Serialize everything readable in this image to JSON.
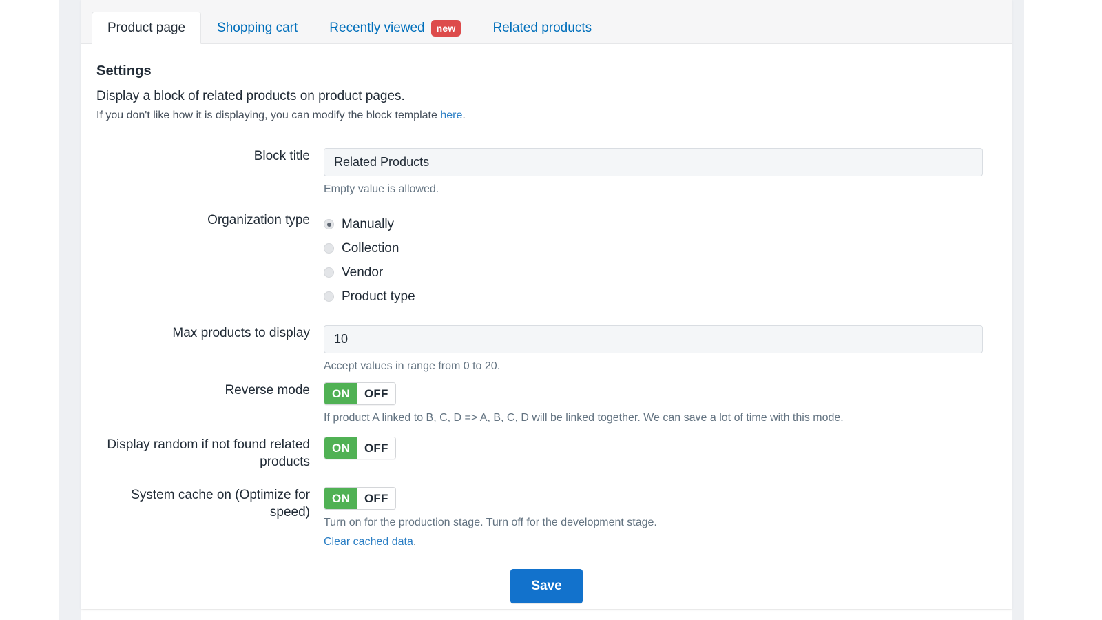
{
  "tabs": [
    {
      "label": "Product page",
      "active": true,
      "badge": null
    },
    {
      "label": "Shopping cart",
      "active": false,
      "badge": null
    },
    {
      "label": "Recently viewed",
      "active": false,
      "badge": "new"
    },
    {
      "label": "Related products",
      "active": false,
      "badge": null
    }
  ],
  "settings": {
    "title": "Settings",
    "description": "Display a block of related products on product pages.",
    "sub_prefix": "If you don't like how it is displaying, you can modify the block template ",
    "sub_link": "here",
    "sub_suffix": "."
  },
  "fields": {
    "block_title": {
      "label": "Block title",
      "value": "Related Products",
      "placeholder": "",
      "help": "Empty value is allowed."
    },
    "organization_type": {
      "label": "Organization type",
      "options": [
        {
          "label": "Manually",
          "checked": true
        },
        {
          "label": "Collection",
          "checked": false
        },
        {
          "label": "Vendor",
          "checked": false
        },
        {
          "label": "Product type",
          "checked": false
        }
      ]
    },
    "max_products": {
      "label": "Max products to display",
      "value": "10",
      "placeholder": "",
      "help": "Accept values in range from 0 to 20."
    },
    "reverse_mode": {
      "label": "Reverse mode",
      "on_label": "ON",
      "off_label": "OFF",
      "state": "on",
      "help": "If product A linked to B, C, D => A, B, C, D will be linked together. We can save a lot of time with this mode."
    },
    "display_random": {
      "label": "Display random if not found related products",
      "on_label": "ON",
      "off_label": "OFF",
      "state": "on"
    },
    "system_cache": {
      "label": "System cache on (Optimize for speed)",
      "on_label": "ON",
      "off_label": "OFF",
      "state": "on",
      "help": "Turn on for the production stage. Turn off for the development stage.",
      "clear_link": "Clear cached data",
      "clear_suffix": "."
    }
  },
  "actions": {
    "save_label": "Save"
  },
  "colors": {
    "accent_blue": "#1272cc",
    "link_blue": "#2a7ec4",
    "tab_blue": "#006fbb",
    "toggle_green": "#50b154",
    "badge_red": "#dd4b4b",
    "text_dark": "#212b36",
    "text_muted": "#637381",
    "card_bg": "#ffffff",
    "tabbar_bg": "#f6f6f7",
    "input_bg": "#f4f6f8"
  }
}
